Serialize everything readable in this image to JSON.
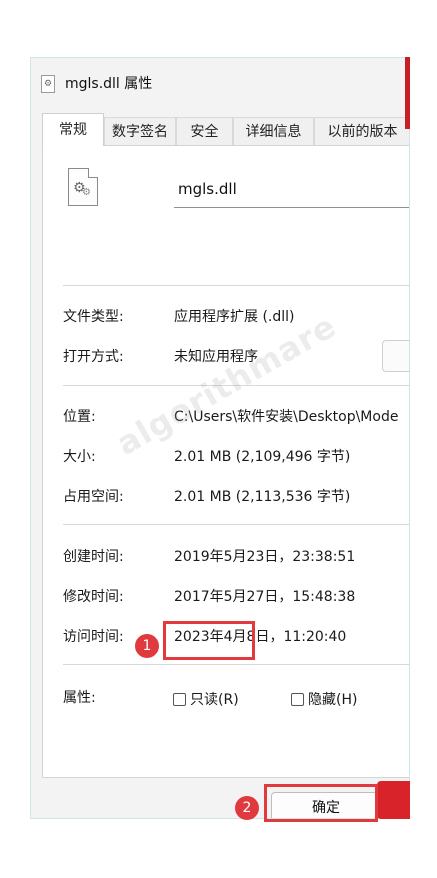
{
  "window": {
    "title": "mgls.dll 属性"
  },
  "tabs": [
    {
      "label": "常规"
    },
    {
      "label": "数字签名"
    },
    {
      "label": "安全"
    },
    {
      "label": "详细信息"
    },
    {
      "label": "以前的版本"
    }
  ],
  "general": {
    "filename": "mgls.dll",
    "file_type_label": "文件类型:",
    "file_type_value": "应用程序扩展 (.dll)",
    "open_with_label": "打开方式:",
    "open_with_value": "未知应用程序",
    "location_label": "位置:",
    "location_value": "C:\\Users\\软件安装\\Desktop\\Mode",
    "size_label": "大小:",
    "size_value": "2.01 MB (2,109,496 字节)",
    "size_on_disk_label": "占用空间:",
    "size_on_disk_value": "2.01 MB (2,113,536 字节)",
    "created_label": "创建时间:",
    "created_value": "2019年5月23日，23:38:51",
    "modified_label": "修改时间:",
    "modified_value": "2017年5月27日，15:48:38",
    "accessed_label": "访问时间:",
    "accessed_value": "2023年4月8日，11:20:40",
    "attributes_label": "属性:",
    "readonly_label": "只读(R)",
    "hidden_label": "隐藏(H)"
  },
  "footer": {
    "ok_label": "确定"
  },
  "annotations": {
    "badge1": "1",
    "badge2": "2"
  },
  "watermark": "algorithmare",
  "colors": {
    "highlight": "#e0393e",
    "window_bg": "#f3f3f3",
    "panel_bg": "#ffffff"
  },
  "icons": {
    "title_icon": "dll-file-icon",
    "file_icon": "dll-gear-file-icon"
  }
}
